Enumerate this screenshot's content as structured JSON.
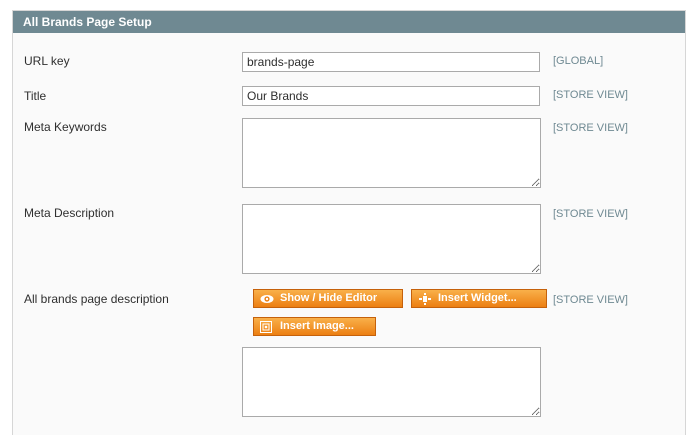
{
  "panel": {
    "title": "All Brands Page Setup"
  },
  "fields": {
    "url_key": {
      "label": "URL key",
      "value": "brands-page",
      "scope": "[GLOBAL]"
    },
    "title": {
      "label": "Title",
      "value": "Our Brands",
      "scope": "[STORE VIEW]"
    },
    "meta_keywords": {
      "label": "Meta Keywords",
      "value": "",
      "scope": "[STORE VIEW]"
    },
    "meta_description": {
      "label": "Meta Description",
      "value": "",
      "scope": "[STORE VIEW]"
    },
    "page_description": {
      "label": "All brands page description",
      "value": "",
      "scope": "[STORE VIEW]"
    }
  },
  "editor_buttons": {
    "show_hide": "Show / Hide Editor",
    "insert_widget": "Insert Widget...",
    "insert_image": "Insert Image..."
  },
  "icons": {
    "show_hide": "eye-icon",
    "insert_widget": "widget-icon",
    "insert_image": "image-icon"
  },
  "colors": {
    "header_bg": "#6f8992",
    "button_orange": "#ec7f12",
    "scope_text": "#6f8992"
  }
}
